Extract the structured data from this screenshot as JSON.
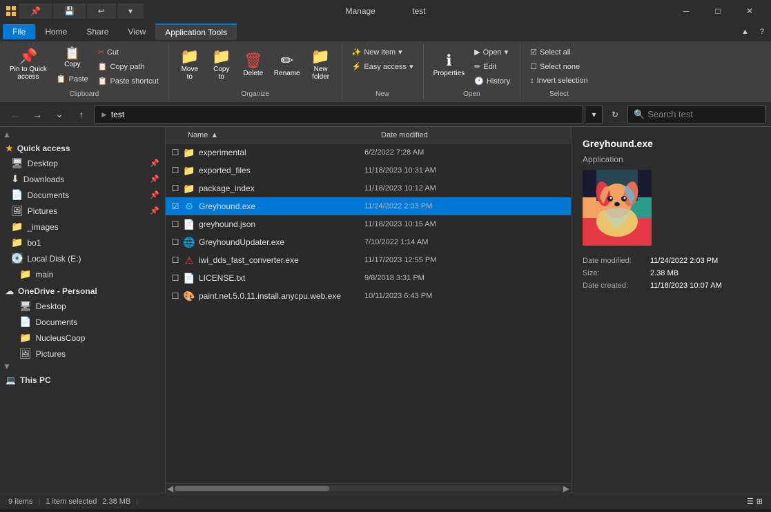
{
  "window": {
    "title": "test",
    "manage_tab": "Manage",
    "controls": {
      "minimize": "─",
      "maximize": "□",
      "close": "✕"
    }
  },
  "ribbon": {
    "tabs": [
      "File",
      "Home",
      "Share",
      "View",
      "Application Tools"
    ],
    "active_tab": "Application Tools",
    "manage_label": "Manage",
    "groups": {
      "clipboard": {
        "label": "Clipboard",
        "pin_label": "Pin to Quick\naccess",
        "copy_label": "Copy",
        "paste_label": "Paste",
        "cut_label": "Cut",
        "copy_path_label": "Copy path",
        "paste_shortcut_label": "Paste shortcut"
      },
      "organize": {
        "label": "Organize",
        "move_to_label": "Move\nto",
        "copy_to_label": "Copy\nto",
        "delete_label": "Delete",
        "rename_label": "Rename",
        "new_folder_label": "New\nfolder"
      },
      "new_group": {
        "label": "New",
        "new_item_label": "New item",
        "easy_access_label": "Easy access"
      },
      "open_group": {
        "label": "Open",
        "open_label": "Open",
        "edit_label": "Edit",
        "history_label": "History",
        "properties_label": "Properties"
      },
      "select": {
        "label": "Select",
        "select_all_label": "Select all",
        "select_none_label": "Select none",
        "invert_label": "Invert selection"
      }
    }
  },
  "addressbar": {
    "path": "test",
    "search_placeholder": "Search test"
  },
  "sidebar": {
    "quick_access_label": "Quick access",
    "items": [
      {
        "label": "Desktop",
        "pin": true,
        "icon": "🖥"
      },
      {
        "label": "Downloads",
        "pin": true,
        "icon": "⬇"
      },
      {
        "label": "Documents",
        "pin": true,
        "icon": "📄"
      },
      {
        "label": "Pictures",
        "pin": true,
        "icon": "🖼"
      },
      {
        "label": "_images",
        "pin": false,
        "icon": "📁"
      },
      {
        "label": "bo1",
        "pin": false,
        "icon": "📁"
      }
    ],
    "local_disk_label": "Local Disk (E:)",
    "main_label": "main",
    "onedrive_label": "OneDrive - Personal",
    "onedrive_items": [
      {
        "label": "Desktop",
        "icon": "🖥"
      },
      {
        "label": "Documents",
        "icon": "📄"
      },
      {
        "label": "NucleusCoop",
        "icon": "📁"
      },
      {
        "label": "Pictures",
        "icon": "🖼"
      }
    ],
    "this_pc_label": "This PC"
  },
  "file_list": {
    "columns": [
      "Name",
      "Date modified"
    ],
    "files": [
      {
        "name": "experimental",
        "date": "6/2/2022 7:28 AM",
        "type": "folder",
        "selected": false
      },
      {
        "name": "exported_files",
        "date": "11/18/2023 10:31 AM",
        "type": "folder",
        "selected": false
      },
      {
        "name": "package_index",
        "date": "11/18/2023 10:12 AM",
        "type": "folder",
        "selected": false
      },
      {
        "name": "Greyhound.exe",
        "date": "11/24/2022 2:03 PM",
        "type": "exe",
        "selected": true
      },
      {
        "name": "greyhound.json",
        "date": "11/18/2023 10:15 AM",
        "type": "json",
        "selected": false
      },
      {
        "name": "GreyhoundUpdater.exe",
        "date": "7/10/2022 1:14 AM",
        "type": "exe",
        "selected": false
      },
      {
        "name": "iwi_dds_fast_converter.exe",
        "date": "11/17/2023 12:55 PM",
        "type": "exe_red",
        "selected": false
      },
      {
        "name": "LICENSE.txt",
        "date": "9/8/2018 3:31 PM",
        "type": "txt",
        "selected": false
      },
      {
        "name": "paint.net.5.0.11.install.anycpu.web.exe",
        "date": "10/11/2023 6:43 PM",
        "type": "exe",
        "selected": false
      }
    ]
  },
  "preview": {
    "filename": "Greyhound.exe",
    "type": "Application",
    "date_modified_label": "Date modified:",
    "date_modified_value": "11/24/2022 2:03 PM",
    "size_label": "Size:",
    "size_value": "2.38 MB",
    "date_created_label": "Date created:",
    "date_created_value": "11/18/2023 10:07 AM"
  },
  "statusbar": {
    "item_count": "9 items",
    "selection": "1 item selected",
    "size": "2.38 MB"
  }
}
